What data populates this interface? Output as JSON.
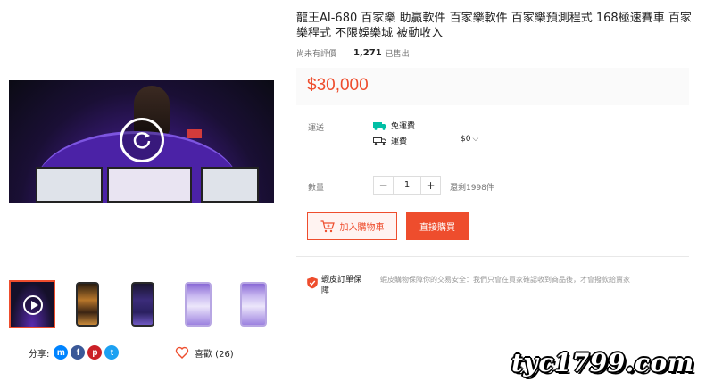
{
  "product": {
    "title": "龍王AI-680 百家樂 助贏軟件 百家樂軟件 百家樂預測程式 168極速賽車 百家樂程式 不限娛樂城 被動收入",
    "rating_text": "尚未有評價",
    "sold_count": "1,271",
    "sold_label": "已售出",
    "price": "$30,000"
  },
  "shipping": {
    "label": "運送",
    "free_label": "免運費",
    "fee_label": "運費",
    "fee_value": "$0"
  },
  "quantity": {
    "label": "數量",
    "minus": "−",
    "value": "1",
    "plus": "+",
    "stock": "還剩1998件"
  },
  "actions": {
    "add_to_cart": "加入購物車",
    "buy_now": "直接購買"
  },
  "guarantee": {
    "title": "蝦皮訂單保障",
    "desc": "蝦皮購物保障你的交易安全：我們只會在買家確認收到商品後，才會撥款給賣家"
  },
  "share": {
    "label": "分享:",
    "icons": [
      "messenger-icon",
      "facebook-icon",
      "pinterest-icon",
      "twitter-icon"
    ]
  },
  "like": {
    "label": "喜歡 (26)"
  },
  "watermark": "tyc1799.com",
  "colors": {
    "accent": "#ee4d2d",
    "shipping_teal": "#00bfa5"
  }
}
